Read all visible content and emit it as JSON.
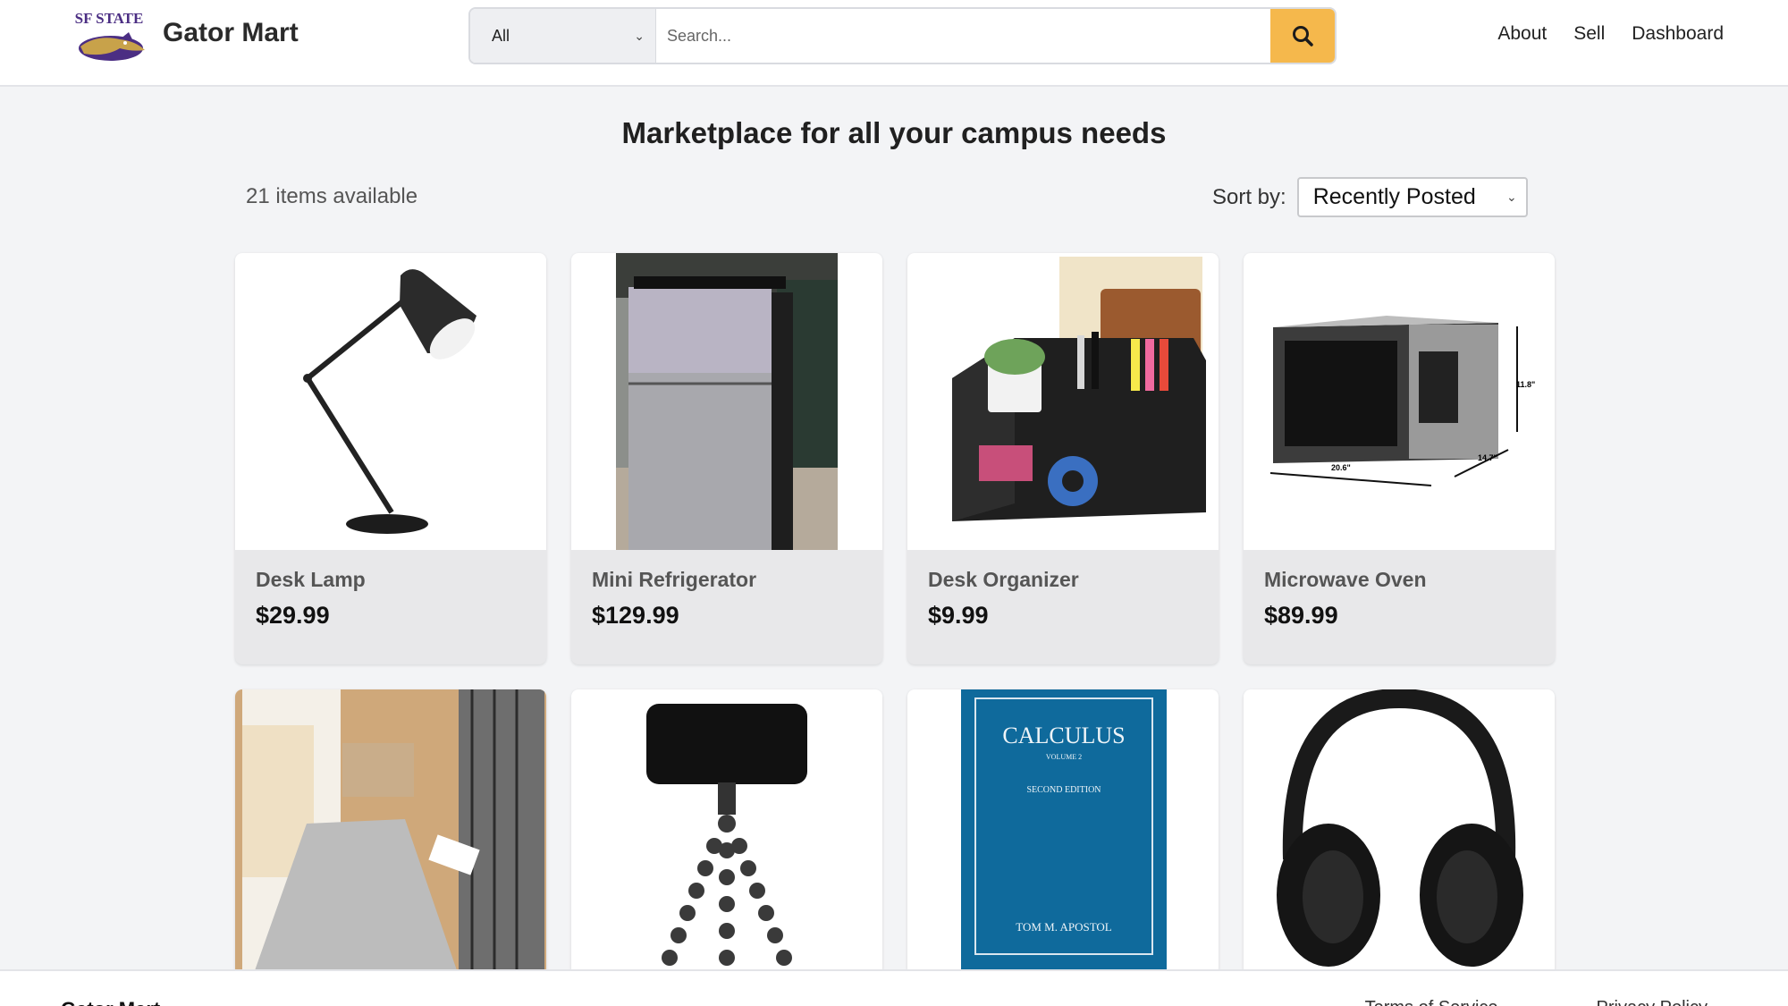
{
  "header": {
    "brand": "Gator Mart",
    "logo_text": "SF STATE",
    "search": {
      "category": "All",
      "placeholder": "Search..."
    },
    "nav": [
      "About",
      "Sell",
      "Dashboard"
    ]
  },
  "main": {
    "headline": "Marketplace for all your campus needs",
    "count_text": "21 items available",
    "sort_label": "Sort by:",
    "sort_value": "Recently Posted"
  },
  "listings": [
    {
      "title": "Desk Lamp",
      "price": "$29.99",
      "image_icon": "desk-lamp-image"
    },
    {
      "title": "Mini Refrigerator",
      "price": "$129.99",
      "image_icon": "mini-fridge-image"
    },
    {
      "title": "Desk Organizer",
      "price": "$9.99",
      "image_icon": "desk-organizer-image"
    },
    {
      "title": "Microwave Oven",
      "price": "$89.99",
      "image_icon": "microwave-image"
    },
    {
      "title": "",
      "price": "",
      "image_icon": "rug-image"
    },
    {
      "title": "",
      "price": "",
      "image_icon": "phone-tripod-image"
    },
    {
      "title": "",
      "price": "",
      "image_icon": "calculus-book-image"
    },
    {
      "title": "",
      "price": "",
      "image_icon": "headphones-image"
    }
  ],
  "images": {
    "microwave_dims": [
      "11.8\"",
      "20.6\"",
      "14.7\""
    ],
    "book_title": "CALCULUS",
    "book_volume": "VOLUME 2",
    "book_edition": "SECOND EDITION",
    "book_author": "TOM M. APOSTOL"
  },
  "footer": {
    "brand": "Gator Mart",
    "links": [
      "Terms of Service",
      "Privacy Policy"
    ]
  },
  "colors": {
    "accent": "#f5b84c",
    "page_bg": "#f3f4f6",
    "card_bg": "#e8e8ea",
    "book_blue": "#0f6a9c"
  }
}
